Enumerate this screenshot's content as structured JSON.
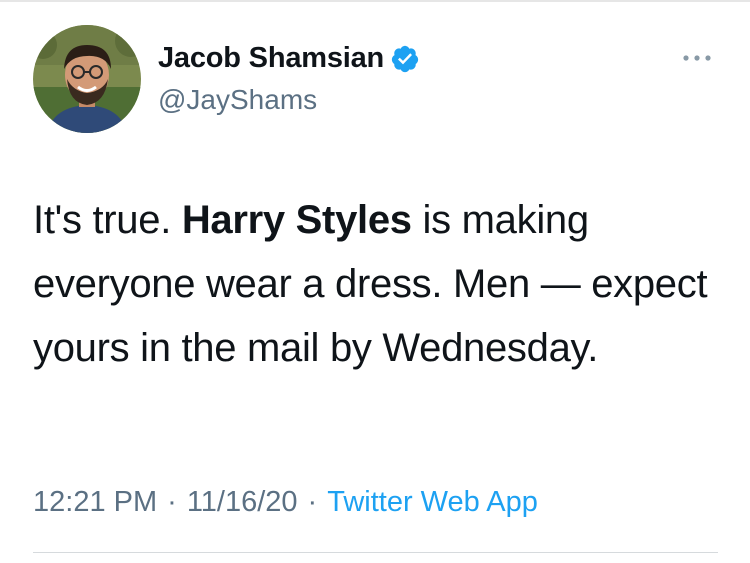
{
  "author": {
    "display_name": "Jacob Shamsian",
    "handle": "@JayShams",
    "verified": true
  },
  "tweet": {
    "text_before": "It's true. ",
    "text_bold": "Harry Styles",
    "text_after": " is making everyone wear a dress. Men — expect yours in the mail by Wednesday.",
    "time": "12:21 PM",
    "separator": "·",
    "date": "11/16/20",
    "source": "Twitter Web App"
  },
  "icons": {
    "verified": "verified-badge-icon",
    "more": "more-options-icon"
  },
  "colors": {
    "accent": "#1da1f2",
    "secondary_text": "#5b7083",
    "primary_text": "#0f1419"
  }
}
